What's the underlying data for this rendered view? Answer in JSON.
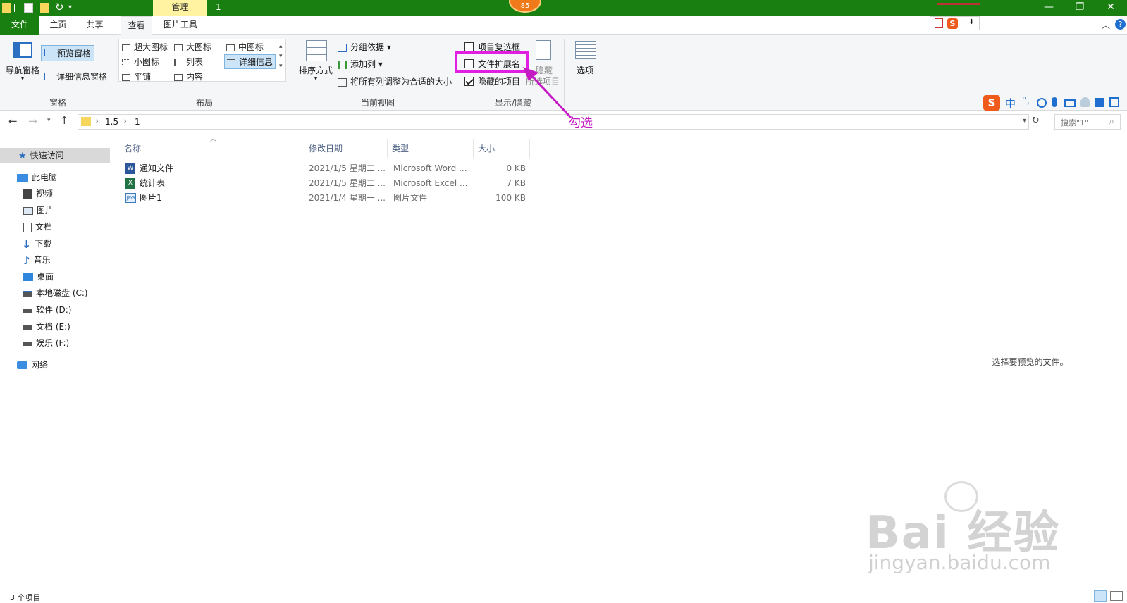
{
  "window": {
    "title": "1",
    "manage_tab": "管理",
    "badge": "85",
    "minimize": "—",
    "restore": "❐",
    "close": "✕"
  },
  "tabs": {
    "file": "文件",
    "home": "主页",
    "share": "共享",
    "view": "查看",
    "picture_tools": "图片工具"
  },
  "ribbon": {
    "panes": {
      "nav_pane": "导航窗格",
      "preview_pane": "预览窗格",
      "details_pane": "详细信息窗格",
      "label": "窗格"
    },
    "layout": {
      "extra_large": "超大图标",
      "large": "大图标",
      "medium": "中图标",
      "small": "小图标",
      "list": "列表",
      "details": "详细信息",
      "tiles": "平铺",
      "content": "内容",
      "label": "布局"
    },
    "current_view": {
      "sort_by": "排序方式",
      "group_by": "分组依据",
      "add_columns": "添加列",
      "size_all_columns": "将所有列调整为合适的大小",
      "label": "当前视图"
    },
    "show_hide": {
      "item_checkboxes": "项目复选框",
      "file_extensions": "文件扩展名",
      "hidden_items": "隐藏的项目",
      "hide_selected_1": "隐藏",
      "hide_selected_2": "所选项目",
      "label": "显示/隐藏"
    },
    "options": "选项"
  },
  "address": {
    "crumb1": "1.5",
    "crumb2": "1",
    "search_placeholder": "搜索\"1\""
  },
  "nav": {
    "quick_access": "快速访问",
    "this_pc": "此电脑",
    "videos": "视频",
    "pictures": "图片",
    "documents": "文档",
    "downloads": "下载",
    "music": "音乐",
    "desktop": "桌面",
    "drive_c": "本地磁盘 (C:)",
    "drive_d": "软件 (D:)",
    "drive_e": "文档 (E:)",
    "drive_f": "娱乐 (F:)",
    "network": "网络"
  },
  "columns": {
    "name": "名称",
    "modified": "修改日期",
    "type": "类型",
    "size": "大小"
  },
  "files": [
    {
      "name": "通知文件",
      "modified": "2021/1/5 星期二 ...",
      "type": "Microsoft Word ...",
      "size": "0 KB"
    },
    {
      "name": "统计表",
      "modified": "2021/1/5 星期二 ...",
      "type": "Microsoft Excel ...",
      "size": "7 KB"
    },
    {
      "name": "图片1",
      "modified": "2021/1/4 星期一 ...",
      "type": "图片文件",
      "size": "100 KB"
    }
  ],
  "preview_text": "选择要预览的文件。",
  "status": "3 个项目",
  "annotation": "勾选",
  "ime": {
    "zh": "中",
    "punct": "°,"
  },
  "watermark": {
    "main": "Bai 经验",
    "sub": "jingyan.baidu.com"
  },
  "colors": {
    "accent": "#1a7f11",
    "annotation": "#e21ee2"
  }
}
